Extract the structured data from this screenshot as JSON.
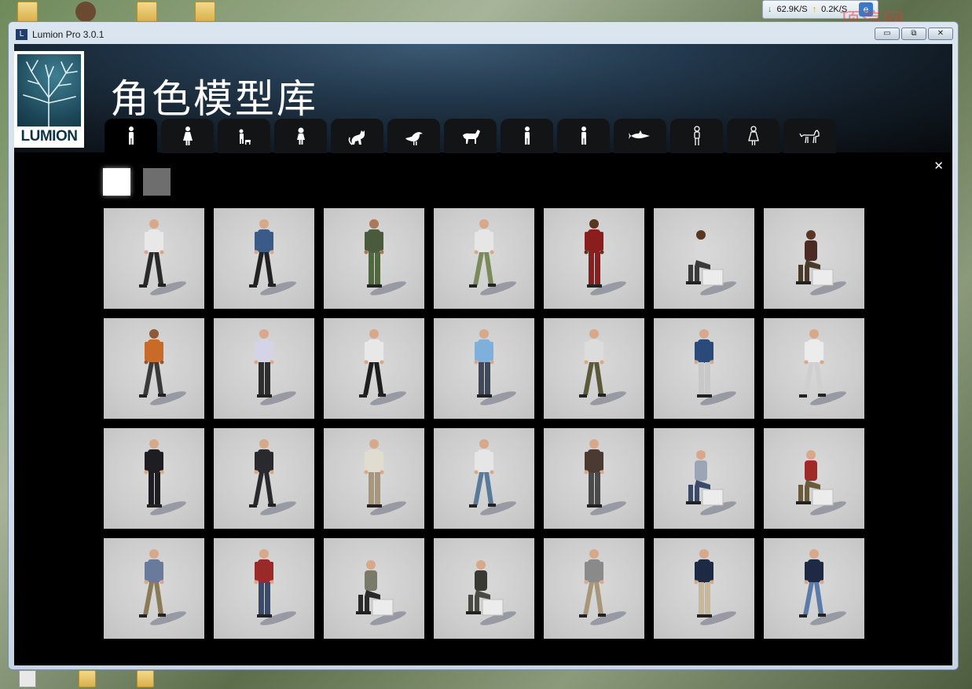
{
  "window": {
    "title": "Lumion Pro  3.0.1",
    "buttons": {
      "minimize": "▭",
      "maximize": "⧉",
      "close": "✕"
    }
  },
  "netbar": {
    "down": "62.9K/S",
    "up": "0.2K/S"
  },
  "desktop": {
    "watermark": "顶渲网"
  },
  "header": {
    "logo": "LUMION",
    "title": "角色模型库"
  },
  "tabs": [
    {
      "icon": "man-icon"
    },
    {
      "icon": "woman-icon"
    },
    {
      "icon": "child-pet-icon"
    },
    {
      "icon": "girl-icon"
    },
    {
      "icon": "cat-icon"
    },
    {
      "icon": "bird-icon"
    },
    {
      "icon": "horse-icon"
    },
    {
      "icon": "man-icon-2"
    },
    {
      "icon": "man-icon-3"
    },
    {
      "icon": "fish-icon"
    },
    {
      "icon": "man-outline-icon"
    },
    {
      "icon": "woman-outline-icon"
    },
    {
      "icon": "dog-outline-icon"
    }
  ],
  "swatches": {
    "white": "#ffffff",
    "gray": "#6e6e6e"
  },
  "models": [
    {
      "shirt": "#e8e8e8",
      "pants": "#2a2a2a",
      "skin": "#d7a98a",
      "pose": "walk"
    },
    {
      "shirt": "#3a5a88",
      "pants": "#222222",
      "skin": "#d7a98a",
      "pose": "walk"
    },
    {
      "shirt": "#4a5a3c",
      "pants": "#4e6a3a",
      "skin": "#a97a5a",
      "pose": "stand"
    },
    {
      "shirt": "#e6e6e6",
      "pants": "#7a8a5a",
      "skin": "#d7a98a",
      "pose": "walk"
    },
    {
      "shirt": "#8a1e1e",
      "pants": "#8a1e1e",
      "skin": "#5a3622",
      "pose": "stand"
    },
    {
      "shirt": "#d8d8d8",
      "pants": "#3a3a3a",
      "skin": "#5a3622",
      "pose": "sit"
    },
    {
      "shirt": "#4a2a22",
      "pants": "#4a3a2a",
      "skin": "#5a3622",
      "pose": "sit"
    },
    {
      "shirt": "#c86a28",
      "pants": "#3a3a3a",
      "skin": "#8a5a3a",
      "pose": "walk"
    },
    {
      "shirt": "#d4d4e6",
      "pants": "#2e2e2e",
      "skin": "#d7a98a",
      "pose": "stand"
    },
    {
      "shirt": "#e8e8e8",
      "pants": "#1e1e1e",
      "skin": "#d7a98a",
      "pose": "walk"
    },
    {
      "shirt": "#7fb0dc",
      "pants": "#3e4a5a",
      "skin": "#d7a98a",
      "pose": "stand"
    },
    {
      "shirt": "#dcdcdc",
      "pants": "#5a5a3a",
      "skin": "#d7a98a",
      "pose": "walk"
    },
    {
      "shirt": "#2a4a7a",
      "pants": "#c8c8c8",
      "skin": "#d7a98a",
      "pose": "stand"
    },
    {
      "shirt": "#ececec",
      "pants": "#cfcfcf",
      "skin": "#d7a98a",
      "pose": "walk"
    },
    {
      "shirt": "#1e1e22",
      "pants": "#1e1e22",
      "skin": "#d7a98a",
      "pose": "stand"
    },
    {
      "shirt": "#2a2a2e",
      "pants": "#2a2a2e",
      "skin": "#d7a98a",
      "pose": "walk"
    },
    {
      "shirt": "#e0dcd0",
      "pants": "#a8967a",
      "skin": "#d7a98a",
      "pose": "stand"
    },
    {
      "shirt": "#e6e6e6",
      "pants": "#5a7a9a",
      "skin": "#d7a98a",
      "pose": "walk"
    },
    {
      "shirt": "#4a3a32",
      "pants": "#4a4a4a",
      "skin": "#d7a98a",
      "pose": "stand"
    },
    {
      "shirt": "#9aa6b6",
      "pants": "#3a4a6a",
      "skin": "#d7a98a",
      "pose": "sit"
    },
    {
      "shirt": "#a02a2a",
      "pants": "#6a5a3a",
      "skin": "#d7a98a",
      "pose": "sit"
    },
    {
      "shirt": "#6a7a9a",
      "pants": "#8a7a5a",
      "skin": "#d7a98a",
      "pose": "walk"
    },
    {
      "shirt": "#9a2a2a",
      "pants": "#3a4a6a",
      "skin": "#d7a98a",
      "pose": "stand"
    },
    {
      "shirt": "#7a7a6a",
      "pants": "#2a2a2a",
      "skin": "#d7a98a",
      "pose": "sit"
    },
    {
      "shirt": "#3a3a34",
      "pants": "#4a4a44",
      "skin": "#d7a98a",
      "pose": "sit"
    },
    {
      "shirt": "#8a8a8a",
      "pants": "#a8967a",
      "skin": "#d7a98a",
      "pose": "walk"
    },
    {
      "shirt": "#1e2a44",
      "pants": "#c8b89a",
      "skin": "#d7a98a",
      "pose": "stand"
    },
    {
      "shirt": "#1e2a44",
      "pants": "#5a7aa8",
      "skin": "#d7a98a",
      "pose": "walk"
    }
  ]
}
